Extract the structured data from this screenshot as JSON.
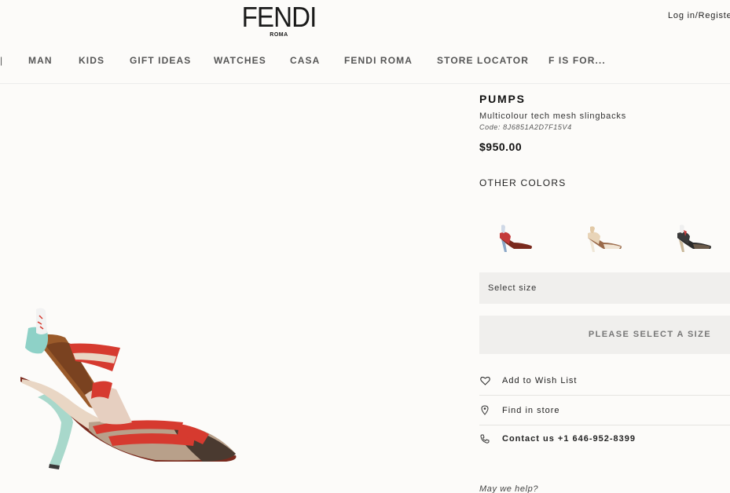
{
  "header": {
    "logo_main": "FENDI",
    "logo_sub": "ROMA",
    "login": "Log in/Register"
  },
  "nav": {
    "items": [
      "MAN",
      "KIDS",
      "GIFT IDEAS",
      "WATCHES",
      "CASA",
      "FENDI ROMA",
      "STORE LOCATOR",
      "F IS FOR..."
    ]
  },
  "product": {
    "category": "PUMPS",
    "name": "Multicolour tech mesh slingbacks",
    "code": "Code: 8J6851A2D7F15V4",
    "price": "$950.00",
    "other_colors_label": "OTHER COLORS",
    "select_size": "Select size",
    "cta": "PLEASE SELECT A SIZE"
  },
  "actions": {
    "wishlist": "Add to Wish List",
    "find_store": "Find in store",
    "contact": "Contact us +1 646-952-8399",
    "help": "May we help?"
  },
  "colors": {
    "accent_red": "#d63a2f",
    "panel_gray": "#f0efed",
    "background": "#fcfbf9"
  }
}
